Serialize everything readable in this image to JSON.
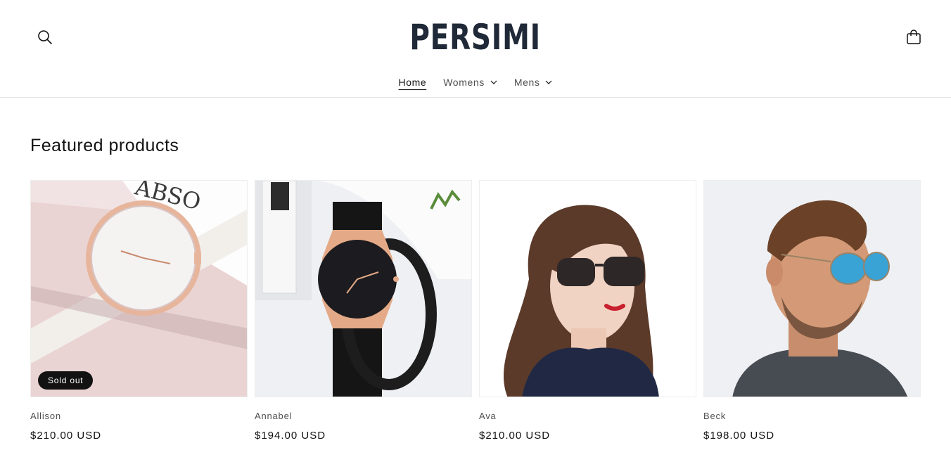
{
  "header": {
    "logo_text": "PERSIMI",
    "search_icon": "search-icon",
    "cart_icon": "cart-icon"
  },
  "nav": {
    "items": [
      {
        "label": "Home",
        "active": true,
        "has_dropdown": false
      },
      {
        "label": "Womens",
        "active": false,
        "has_dropdown": true
      },
      {
        "label": "Mens",
        "active": false,
        "has_dropdown": true
      }
    ]
  },
  "featured": {
    "title": "Featured products",
    "products": [
      {
        "name": "Allison",
        "price": "$210.00 USD",
        "badge": "Sold out",
        "image": "rose-gold-watch-white-strap"
      },
      {
        "name": "Annabel",
        "price": "$194.00 USD",
        "badge": "",
        "image": "rose-gold-watch-black-strap"
      },
      {
        "name": "Ava",
        "price": "$210.00 USD",
        "badge": "",
        "image": "woman-wearing-sunglasses"
      },
      {
        "name": "Beck",
        "price": "$198.00 USD",
        "badge": "",
        "image": "man-wearing-blue-aviators"
      }
    ]
  },
  "colors": {
    "text": "#121212",
    "logo": "#1f2937",
    "badge_bg": "#121212",
    "border": "#e6e6e6"
  }
}
